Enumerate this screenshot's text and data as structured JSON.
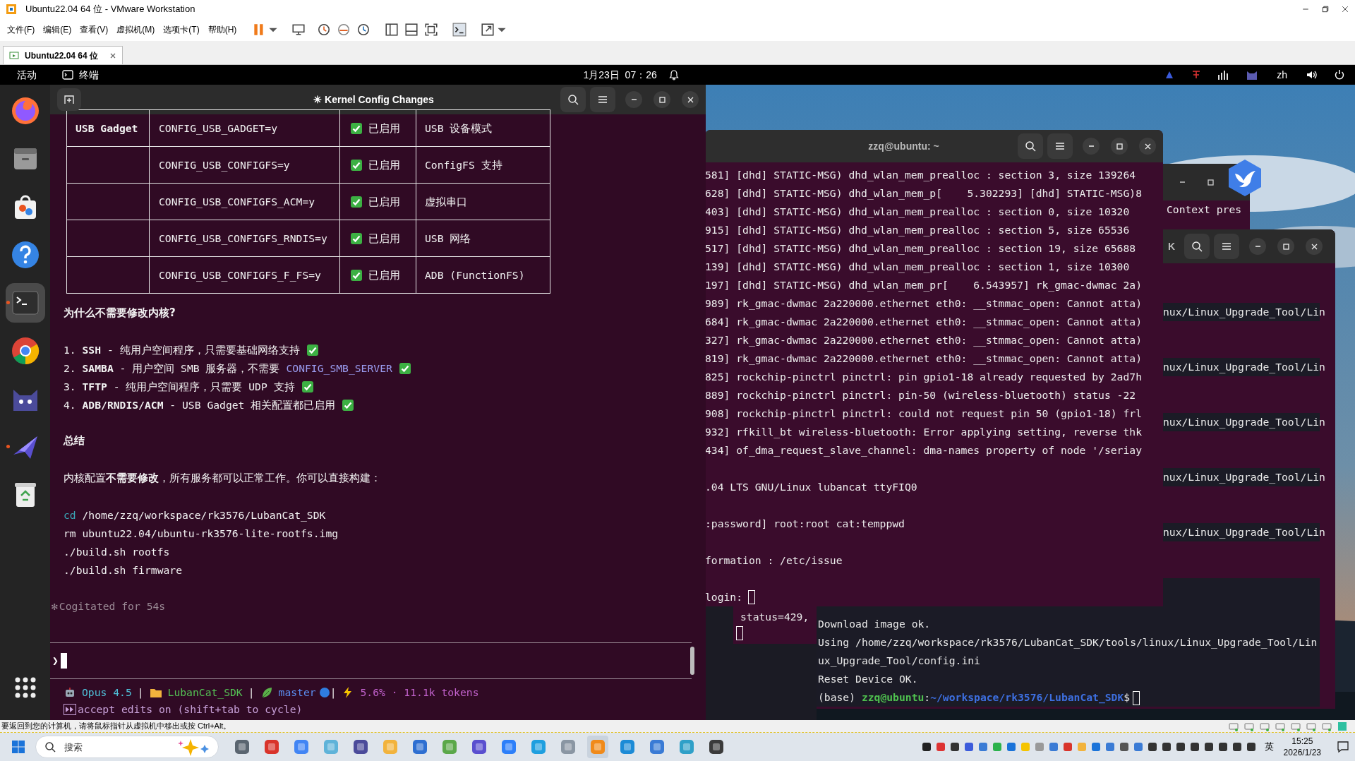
{
  "vmware": {
    "title": "Ubuntu22.04 64 位 - VMware Workstation",
    "menus": [
      "文件(F)",
      "编辑(E)",
      "查看(V)",
      "虚拟机(M)",
      "选项卡(T)",
      "帮助(H)"
    ],
    "tabs": [
      {
        "label": "Ubuntu22.04 64 位",
        "selected": true
      }
    ],
    "status_message": "要返回到您的计算机，请将鼠标指针从虚拟机中移出或按 Ctrl+Alt。"
  },
  "top_bar": {
    "activities": "活动",
    "app_name": "终端",
    "clock": "1月23日  07：26",
    "input_method": "zh"
  },
  "dock": [
    {
      "kind": "firefox",
      "running": false,
      "selected": false
    },
    {
      "kind": "files",
      "running": false,
      "selected": false
    },
    {
      "kind": "software",
      "running": false,
      "selected": false
    },
    {
      "kind": "help",
      "running": false,
      "selected": false
    },
    {
      "kind": "terminal",
      "running": true,
      "selected": true
    },
    {
      "kind": "chrome",
      "running": false,
      "selected": false
    },
    {
      "kind": "cat",
      "running": false,
      "selected": false
    },
    {
      "kind": "plane",
      "running": true,
      "selected": false
    },
    {
      "kind": "trash",
      "running": false,
      "selected": false
    }
  ],
  "main_terminal": {
    "title": "✳ Kernel Config Changes",
    "table": {
      "rows": [
        {
          "column_1": "USB Gadget",
          "column_2": "CONFIG_USB_GADGET=y",
          "enabled": true,
          "column_3": "已启用",
          "column_4": "USB 设备模式"
        },
        {
          "column_2": "CONFIG_USB_CONFIGFS=y",
          "enabled": true,
          "column_3": "已启用",
          "column_4": "ConfigFS 支持"
        },
        {
          "column_2": "CONFIG_USB_CONFIGFS_ACM=y",
          "enabled": true,
          "column_3": "已启用",
          "column_4": "虚拟串口"
        },
        {
          "column_2": "CONFIG_USB_CONFIGFS_RNDIS=y",
          "enabled": true,
          "column_3": "已启用",
          "column_4": "USB 网络"
        },
        {
          "column_2": "CONFIG_USB_CONFIGFS_F_FS=y",
          "enabled": true,
          "column_3": "已启用",
          "column_4": "ADB (FunctionFS)"
        }
      ]
    },
    "heading": "为什么不需要修改内核?",
    "reasons": [
      {
        "text": "1. **SSH** - 纯用户空间程序，只需要基础网络支持",
        "checked": true
      },
      {
        "text": "2. **SAMBA** - 用户空间 SMB 服务器，不需要",
        "code": "CONFIG_SMB_SERVER",
        "checked": true
      },
      {
        "text": "3. **TFTP** - 纯用户空间程序，只需要 UDP 支持",
        "checked": true
      },
      {
        "text": "4. **ADB/RNDIS/ACM** - USB Gadget 相关配置都已启用",
        "checked": true
      }
    ],
    "summary_heading": "总结",
    "summary": "内核配置**不需要修改**，所有服务都可以正常工作。你可以直接构建：",
    "commands": [
      {
        "parts": [
          {
            "kind": "keyword",
            "text": "cd"
          },
          {
            "kind": "plain",
            "text": " /home/zzq/workspace/rk3576/LubanCat_SDK"
          }
        ]
      },
      {
        "parts": [
          {
            "kind": "plain",
            "text": "rm ubuntu22.04/ubuntu-rk3576-lite-rootfs.img"
          }
        ]
      },
      {
        "parts": [
          {
            "kind": "plain",
            "text": "./build.sh rootfs"
          }
        ]
      },
      {
        "parts": [
          {
            "kind": "plain",
            "text": "./build.sh firmware"
          }
        ]
      }
    ],
    "thinking": {
      "mark": "✻",
      "text": "Cogitated for 54s"
    },
    "prompt": "❯",
    "statusline": [
      {
        "kind": "model",
        "text": "Opus 4.5"
      },
      {
        "kind": "separator",
        "text": "|"
      },
      {
        "kind": "folder",
        "text": "LubanCat_SDK"
      },
      {
        "kind": "separator",
        "text": "|"
      },
      {
        "kind": "branch",
        "text": "master"
      },
      {
        "kind": "separator",
        "text": "|"
      },
      {
        "kind": "usage",
        "text": "5.6% · 11.1k tokens"
      }
    ],
    "mode": "accept edits on (shift+tab to cycle)"
  },
  "serial_terminal": {
    "title": "zzq@ubuntu: ~",
    "log_lines": [
      "581] [dhd] STATIC-MSG) dhd_wlan_mem_prealloc : section 3, size 139264",
      "628] [dhd] STATIC-MSG) dhd_wlan_mem_p[    5.302293] [dhd] STATIC-MSG)8",
      "403] [dhd] STATIC-MSG) dhd_wlan_mem_prealloc : section 0, size 10320",
      "915] [dhd] STATIC-MSG) dhd_wlan_mem_prealloc : section 5, size 65536",
      "517] [dhd] STATIC-MSG) dhd_wlan_mem_prealloc : section 19, size 65688",
      "139] [dhd] STATIC-MSG) dhd_wlan_mem_prealloc : section 1, size 10300",
      "197] [dhd] STATIC-MSG) dhd_wlan_mem_pr[    6.543957] rk_gmac-dwmac 2a)",
      "989] rk_gmac-dwmac 2a220000.ethernet eth0: __stmmac_open: Cannot atta)",
      "684] rk_gmac-dwmac 2a220000.ethernet eth0: __stmmac_open: Cannot atta)",
      "327] rk_gmac-dwmac 2a220000.ethernet eth0: __stmmac_open: Cannot atta)",
      "819] rk_gmac-dwmac 2a220000.ethernet eth0: __stmmac_open: Cannot atta)",
      "825] rockchip-pinctrl pinctrl: pin gpio1-18 already requested by 2ad7h",
      "889] rockchip-pinctrl pinctrl: pin-50 (wireless-bluetooth) status -22",
      "908] rockchip-pinctrl pinctrl: could not request pin 50 (gpio1-18) frl",
      "932] rfkill_bt wireless-bluetooth: Error applying setting, reverse thk",
      "434] of_dma_request_slave_channel: dma-names property of node '/seriay"
    ],
    "console_lines": [
      ".04 LTS GNU/Linux lubancat ttyFIQ0",
      ":password] root:root cat:temppwd",
      "formation : /etc/issue",
      "login:"
    ]
  },
  "upgrade_terminal": {
    "title": "K",
    "wrapped_lines": [
      "nux/Linux_Upgrade_Tool/Lin",
      "nux/Linux_Upgrade_Tool/Lin",
      "nux/Linux_Upgrade_Tool/Lin",
      "nux/Linux_Upgrade_Tool/Lin",
      "nux/Linux_Upgrade_Tool/Lin"
    ],
    "lines": [
      "Download image ok.",
      "Using /home/zzq/workspace/rk3576/LubanCat_SDK/tools/linux/Linux_Upgrade_Tool/Lin",
      "ux_Upgrade_Tool/config.ini",
      "Reset Device OK."
    ],
    "prompt": {
      "env": "(base)",
      "user_host": "zzq@ubuntu",
      "separator": ":",
      "path": "~/workspace/rk3576/LubanCat_SDK",
      "symbol": "$"
    }
  },
  "context_window": {
    "text": "Context pres"
  },
  "small_terminal": {
    "text": "status=429,"
  },
  "taskbar": {
    "search_placeholder": "搜索",
    "language": "英",
    "time": "15:25",
    "date": "2026/1/23"
  }
}
